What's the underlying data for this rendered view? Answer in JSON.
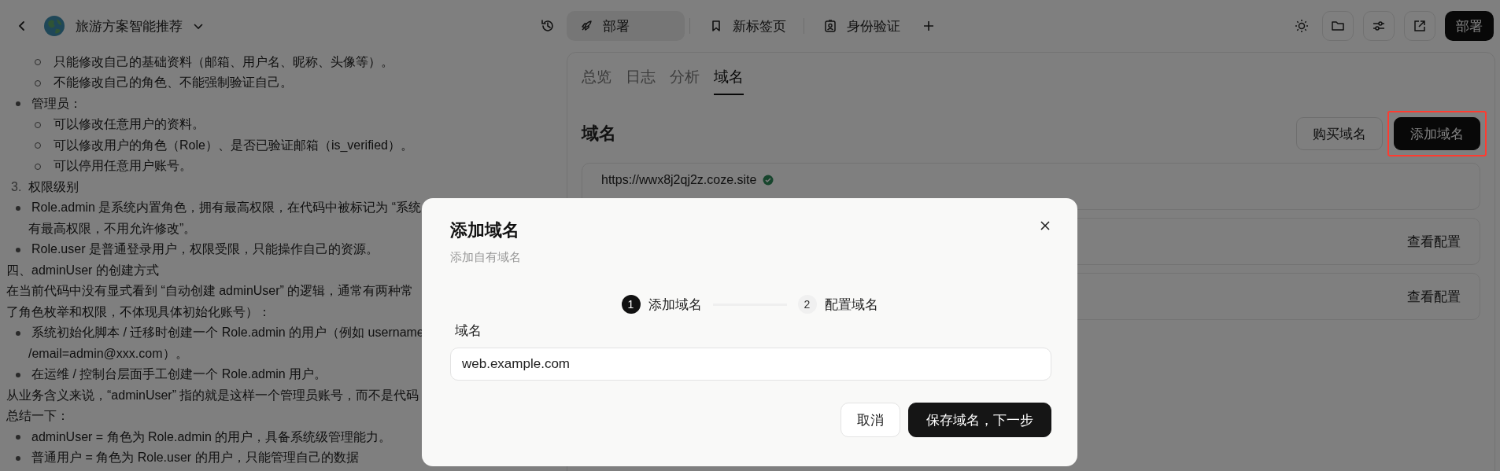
{
  "header": {
    "title": "旅游方案智能推荐",
    "tabs": [
      {
        "label": "部署",
        "selected": true
      },
      {
        "label": "新标签页",
        "selected": false
      },
      {
        "label": "身份验证",
        "selected": false
      }
    ],
    "deploy_button": "部署"
  },
  "document": {
    "lines": [
      {
        "kind": "sub",
        "text": "只能修改自己的基础资料（邮箱、用户名、昵称、头像等）。"
      },
      {
        "kind": "sub",
        "text": "不能修改自己的角色、不能强制验证自己。"
      },
      {
        "kind": "bullet",
        "text": "管理员："
      },
      {
        "kind": "sub",
        "text": "可以修改任意用户的资料。"
      },
      {
        "kind": "sub",
        "text": "可以修改用户的角色（Role）、是否已验证邮箱（is_verified）。"
      },
      {
        "kind": "sub",
        "text": "可以停用任意用户账号。"
      },
      {
        "kind": "numbered",
        "marker": "3.",
        "text": "权限级别"
      },
      {
        "kind": "bullet",
        "text": "Role.admin 是系统内置角色，拥有最高权限，在代码中被标记为 “系统"
      },
      {
        "kind": "continuation",
        "text": "有最高权限，不用允许修改”。"
      },
      {
        "kind": "bullet",
        "text": "Role.user 是普通登录用户，权限受限，只能操作自己的资源。"
      },
      {
        "kind": "plain",
        "text": "四、adminUser 的创建方式"
      },
      {
        "kind": "plain",
        "text": "在当前代码中没有显式看到 “自动创建 adminUser” 的逻辑，通常有两种常"
      },
      {
        "kind": "plain",
        "text": "了角色枚举和权限，不体现具体初始化账号）："
      },
      {
        "kind": "bullet",
        "text": "系统初始化脚本 / 迁移时创建一个 Role.admin 的用户（例如 username"
      },
      {
        "kind": "continuation",
        "text": "/email=admin@xxx.com）。"
      },
      {
        "kind": "bullet",
        "text": "在运维 / 控制台层面手工创建一个 Role.admin 用户。"
      },
      {
        "kind": "plain",
        "text": "从业务含义来说，“adminUser” 指的就是这样一个管理员账号，而不是代码"
      },
      {
        "kind": "plain",
        "text": "总结一下："
      },
      {
        "kind": "bullet",
        "text": "adminUser = 角色为 Role.admin 的用户，具备系统级管理能力。"
      },
      {
        "kind": "bullet",
        "text": "普通用户 = 角色为 Role.user 的用户，只能管理自己的数据"
      }
    ]
  },
  "panel": {
    "tabs": [
      {
        "label": "总览",
        "selected": false
      },
      {
        "label": "日志",
        "selected": false
      },
      {
        "label": "分析",
        "selected": false
      },
      {
        "label": "域名",
        "selected": true
      }
    ],
    "heading": "域名",
    "buttons": [
      {
        "label": "购买域名",
        "primary": false,
        "highlighted": false
      },
      {
        "label": "添加域名",
        "primary": true,
        "highlighted": true
      }
    ],
    "domains": [
      {
        "url": "https://wwx8j2qj2z.coze.site",
        "verified": true
      },
      {
        "action": "查看配置"
      },
      {
        "action": "查看配置"
      }
    ]
  },
  "dialog": {
    "title": "添加域名",
    "subtitle": "添加自有域名",
    "steps": [
      {
        "number": "1",
        "label": "添加域名",
        "selected": true
      },
      {
        "number": "2",
        "label": "配置域名",
        "selected": false
      }
    ],
    "field_label": "域名",
    "field_value": "web.example.com",
    "buttons": [
      {
        "label": "取消",
        "primary": false
      },
      {
        "label": "保存域名，下一步",
        "primary": true
      }
    ]
  }
}
